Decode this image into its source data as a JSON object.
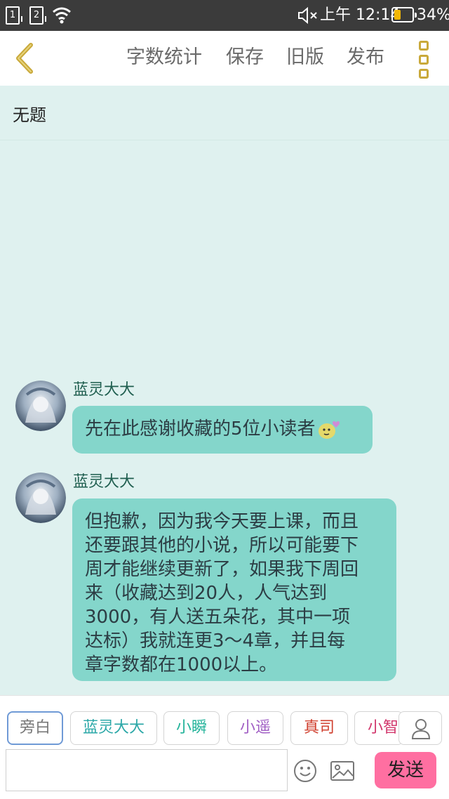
{
  "status_bar": {
    "sim1": "1",
    "sim2": "2",
    "time": "上午 12:14",
    "battery": "34%",
    "battery_level": 0.34,
    "icons": [
      "sim-card-icon",
      "wifi-icon",
      "mute-icon",
      "battery-icon"
    ]
  },
  "toolbar": {
    "back_icon": "chevron-left-icon",
    "word_count": "字数统计",
    "save": "保存",
    "old_version": "旧版",
    "publish": "发布",
    "more_icon": "more-vertical-icon",
    "accent": "#c9a93a"
  },
  "story": {
    "title": "无题"
  },
  "messages": [
    {
      "sender": "蓝灵大大",
      "text": "先在此感谢收藏的5位小读者",
      "emoji": "sticker-emoji-icon"
    },
    {
      "sender": "蓝灵大大",
      "text": "但抱歉，因为我今天要上课，而且\n还要跟其他的小说，所以可能要下\n周才能继续更新了，如果我下周回\n来（收藏达到20人，人气达到\n3000，有人送五朵花，其中一项\n达标）我就连更3～4章，并且每\n章字数都在1000以上。"
    }
  ],
  "characters": [
    {
      "label": "旁白",
      "color": "#777777"
    },
    {
      "label": "蓝灵大大",
      "color": "#2aa7a7"
    },
    {
      "label": "小瞬",
      "color": "#23b39a"
    },
    {
      "label": "小遥",
      "color": "#a15fc4"
    },
    {
      "label": "真司",
      "color": "#d0402f"
    },
    {
      "label": "小智",
      "color": "#d2386d"
    }
  ],
  "composer": {
    "value": "",
    "emoji_icon": "smiley-icon",
    "image_icon": "image-icon",
    "person_icon": "person-icon",
    "send": "发送",
    "send_color": "#ff6fa1"
  },
  "colors": {
    "background": "#dff1ef",
    "bubble": "#84d6cb",
    "sender": "#1f5e4f"
  }
}
